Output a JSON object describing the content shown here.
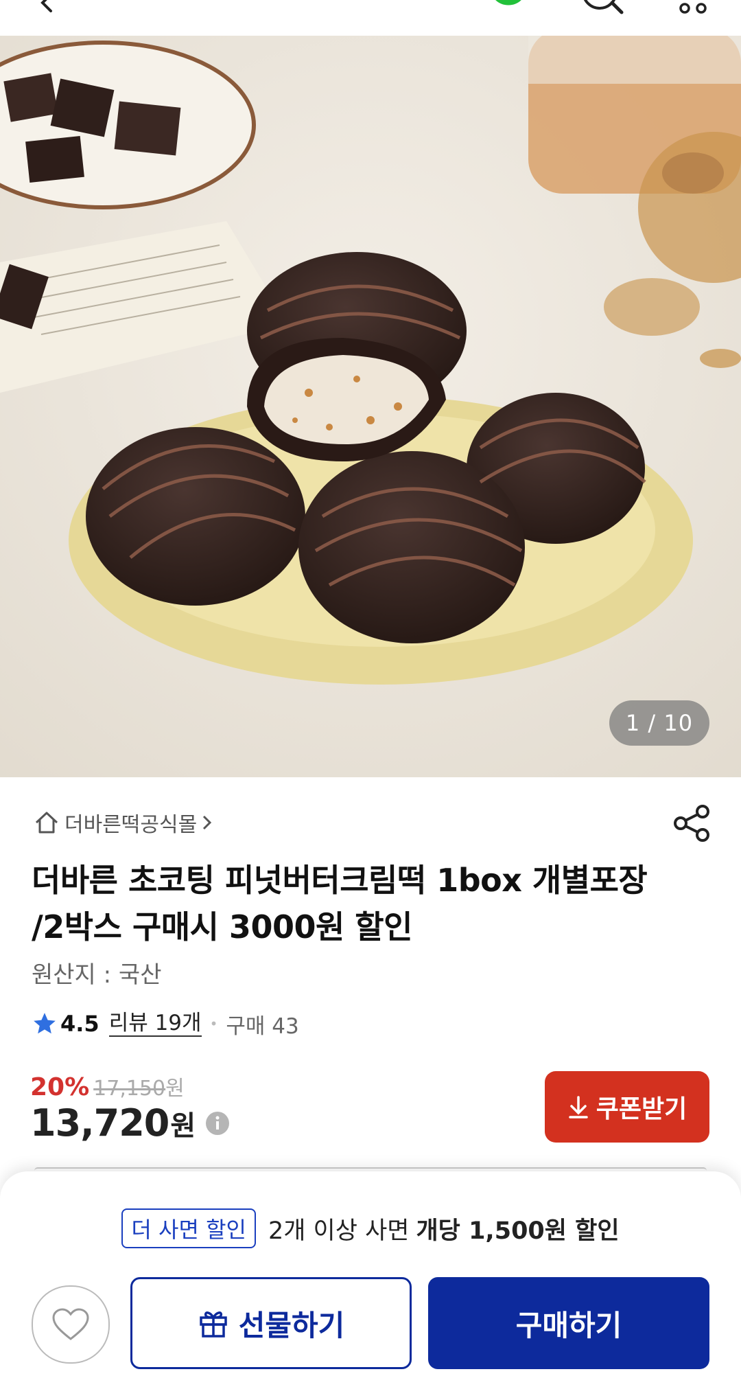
{
  "header": {
    "icons": [
      "back-arrow-icon",
      "green-logo-icon",
      "search-icon",
      "more-icon"
    ]
  },
  "hero": {
    "counter": "1 / 10",
    "image_subject": "chocolate-coated rice cakes on a yellow plate"
  },
  "product": {
    "store_name": "더바른떡공식몰",
    "title": "더바른 초코팅 피넛버터크림떡 1box 개별포장 /2박스 구매시 3000원 할인",
    "origin": "원산지 : 국산",
    "rating": "4.5",
    "review_link": "리뷰 19개",
    "separator": "•",
    "purchase_count": "구매 43",
    "discount_rate": "20%",
    "original_price": "17,150",
    "original_currency": "원",
    "price": "13,720",
    "currency": "원",
    "coupon_label": "쿠폰받기"
  },
  "bottom": {
    "bulk_badge": "더 사면 할인",
    "bulk_text": "2개 이상 사면",
    "bulk_bold": "개당 1,500원 할인",
    "gift_label": "선물하기",
    "buy_label": "구매하기"
  },
  "colors": {
    "accent_red": "#d3311f",
    "primary_blue": "#0d2a9c",
    "star_blue": "#2f6fe0"
  }
}
